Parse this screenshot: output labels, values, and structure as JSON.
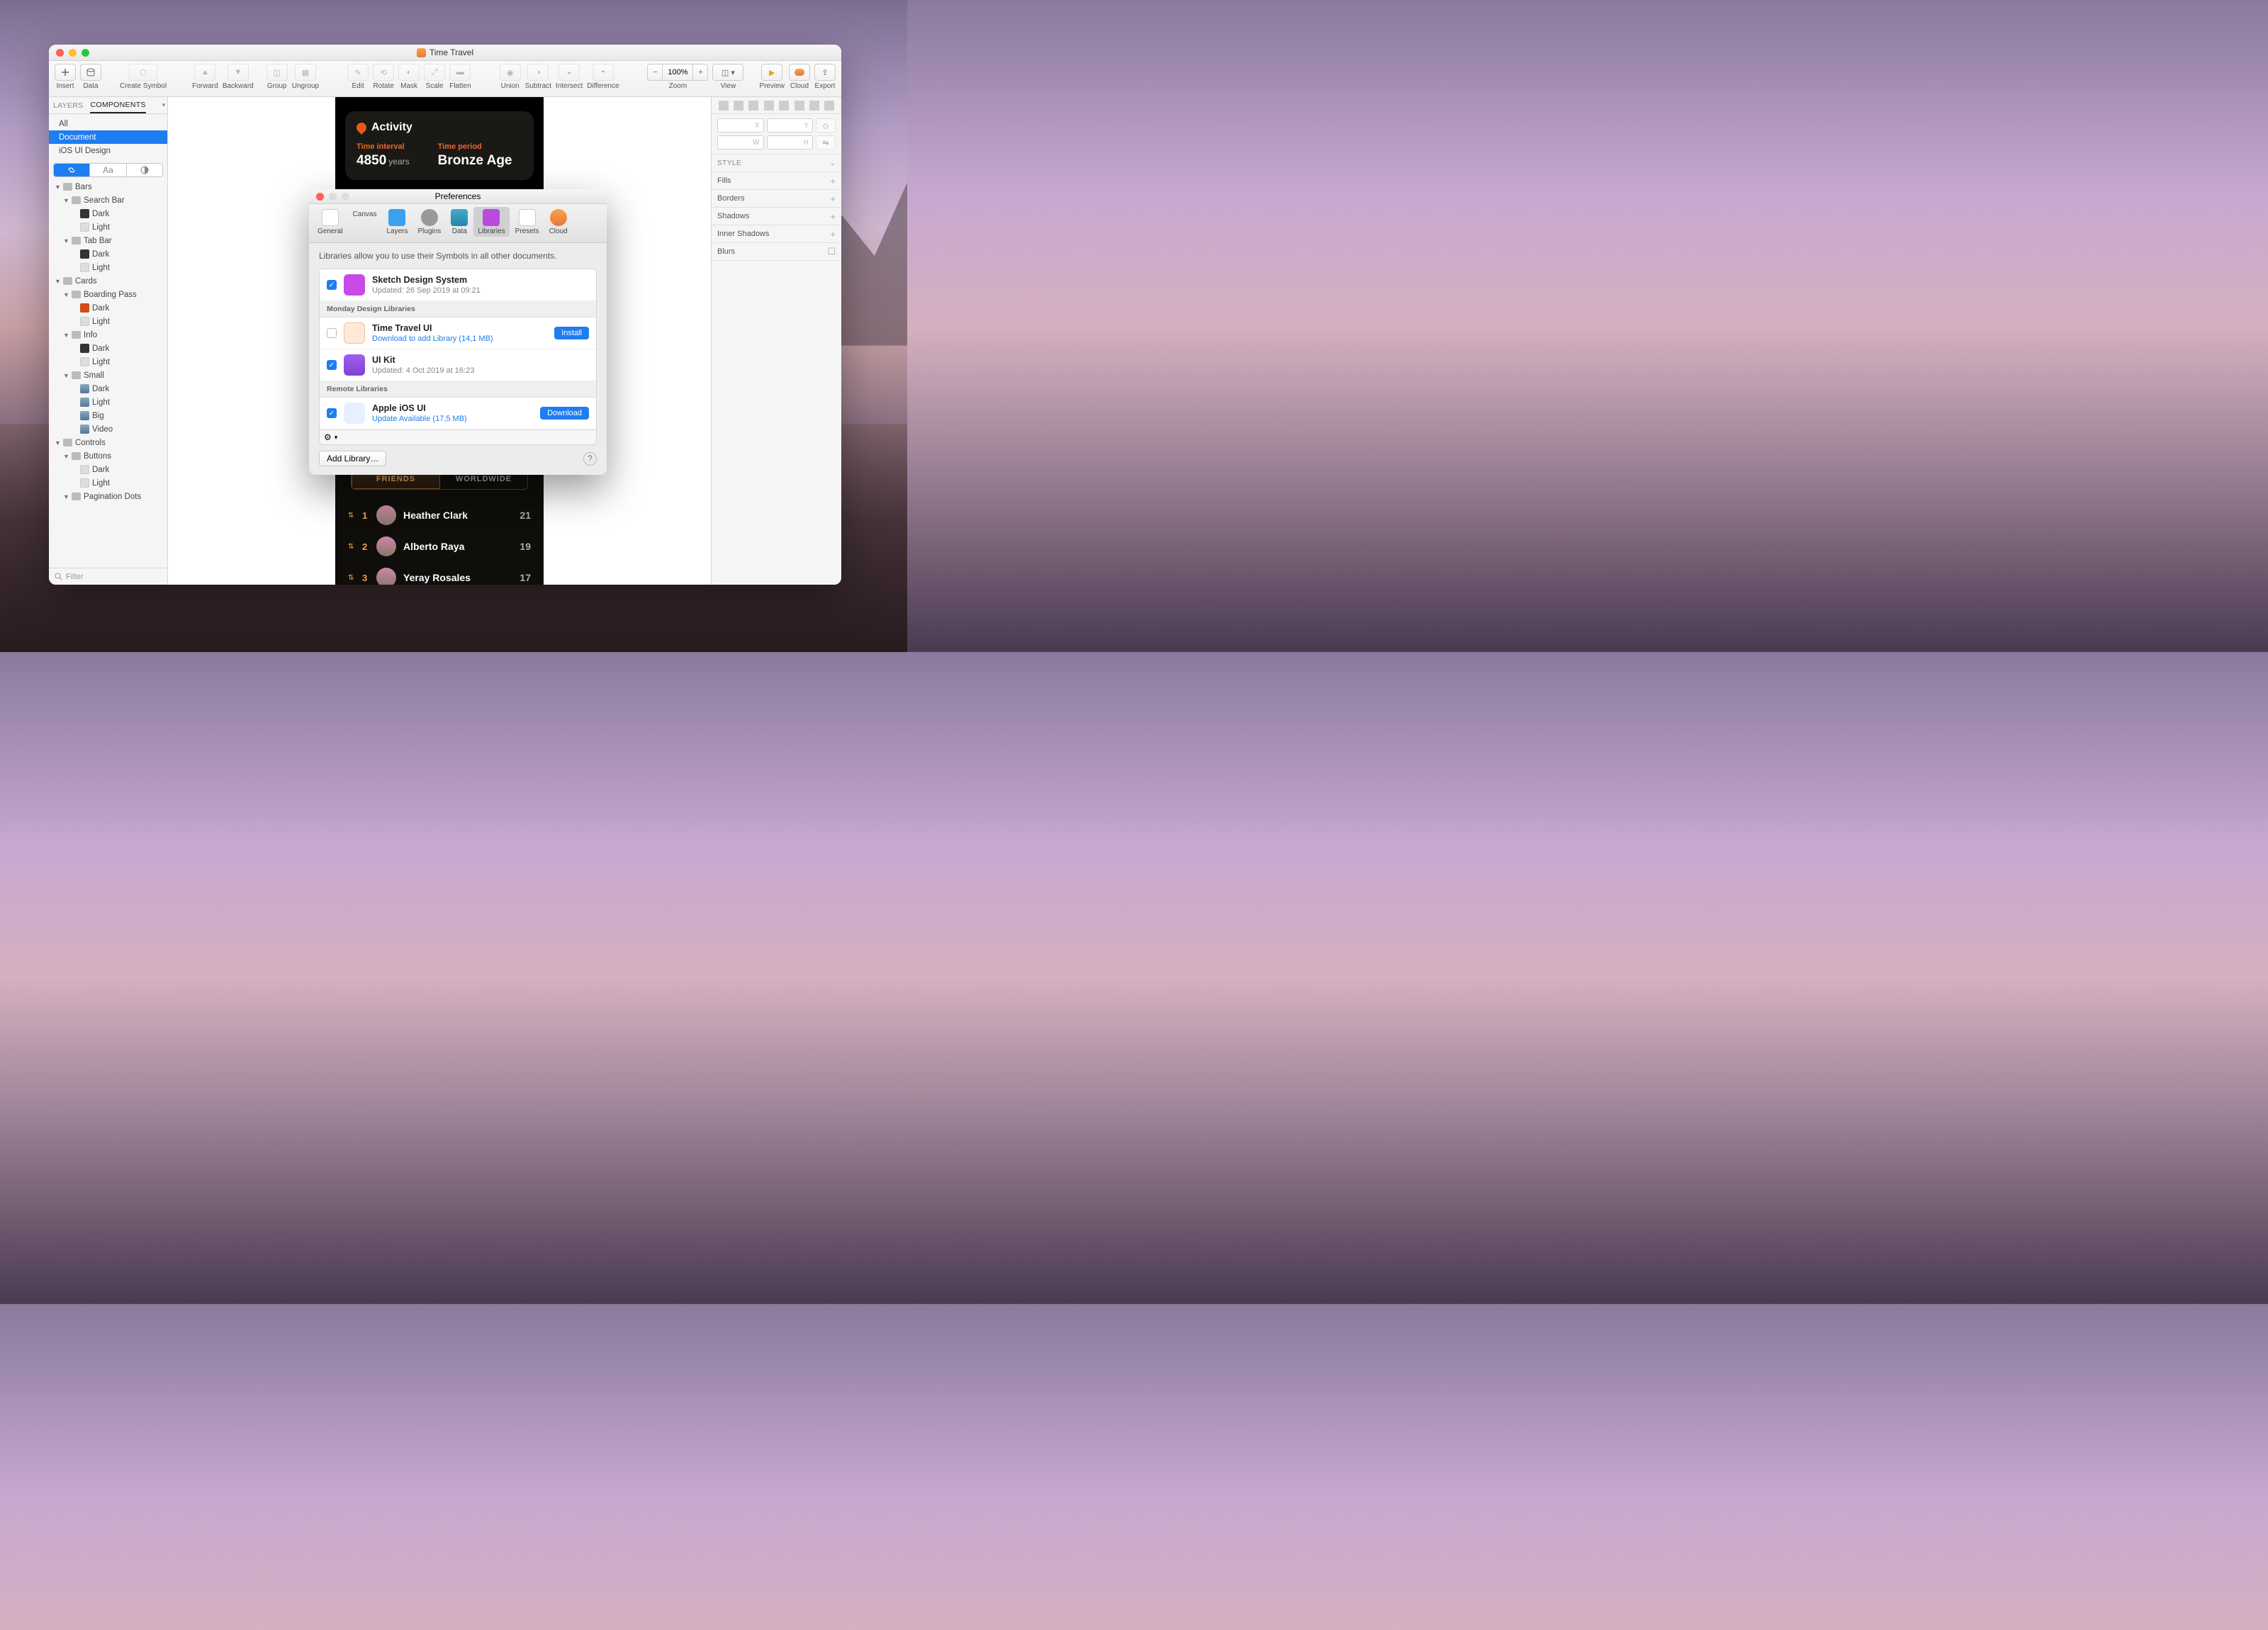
{
  "window": {
    "title": "Time Travel"
  },
  "toolbar": {
    "insert": "Insert",
    "data": "Data",
    "create_symbol": "Create Symbol",
    "forward": "Forward",
    "backward": "Backward",
    "group": "Group",
    "ungroup": "Ungroup",
    "edit": "Edit",
    "rotate": "Rotate",
    "mask": "Mask",
    "scale": "Scale",
    "flatten": "Flatten",
    "union": "Union",
    "subtract": "Subtract",
    "intersect": "Intersect",
    "difference": "Difference",
    "zoom": "Zoom",
    "zoom_value": "100%",
    "view": "View",
    "preview": "Preview",
    "cloud": "Cloud",
    "export": "Export"
  },
  "sidebar": {
    "tabs": {
      "layers": "LAYERS",
      "components": "COMPONENTS"
    },
    "scope": {
      "all": "All",
      "document": "Document",
      "ios": "iOS UI Design"
    },
    "seg": {
      "a": "↻",
      "b": "Aa",
      "c": "◑"
    },
    "tree": [
      {
        "l": 1,
        "d": "▼",
        "i": "f",
        "t": "Bars"
      },
      {
        "l": 2,
        "d": "▼",
        "i": "f",
        "t": "Search Bar"
      },
      {
        "l": 3,
        "d": "",
        "i": "dark",
        "t": "Dark"
      },
      {
        "l": 3,
        "d": "",
        "i": "light",
        "t": "Light"
      },
      {
        "l": 2,
        "d": "▼",
        "i": "f",
        "t": "Tab Bar"
      },
      {
        "l": 3,
        "d": "",
        "i": "dark",
        "t": "Dark"
      },
      {
        "l": 3,
        "d": "",
        "i": "light",
        "t": "Light"
      },
      {
        "l": 1,
        "d": "▼",
        "i": "f",
        "t": "Cards"
      },
      {
        "l": 2,
        "d": "▼",
        "i": "f",
        "t": "Boarding Pass"
      },
      {
        "l": 3,
        "d": "",
        "i": "o1",
        "t": "Dark"
      },
      {
        "l": 3,
        "d": "",
        "i": "light",
        "t": "Light"
      },
      {
        "l": 2,
        "d": "▼",
        "i": "f",
        "t": "Info"
      },
      {
        "l": 3,
        "d": "",
        "i": "dark",
        "t": "Dark"
      },
      {
        "l": 3,
        "d": "",
        "i": "light",
        "t": "Light"
      },
      {
        "l": 2,
        "d": "▼",
        "i": "f",
        "t": "Small"
      },
      {
        "l": 3,
        "d": "",
        "i": "pic",
        "t": "Dark"
      },
      {
        "l": 3,
        "d": "",
        "i": "pic",
        "t": "Light"
      },
      {
        "l": 3,
        "d": "",
        "i": "pic",
        "t": "Big"
      },
      {
        "l": 3,
        "d": "",
        "i": "pic",
        "t": "Video"
      },
      {
        "l": 1,
        "d": "▼",
        "i": "f",
        "t": "Controls"
      },
      {
        "l": 2,
        "d": "▼",
        "i": "f",
        "t": "Buttons"
      },
      {
        "l": 3,
        "d": "",
        "i": "light",
        "t": "Dark"
      },
      {
        "l": 3,
        "d": "",
        "i": "light",
        "t": "Light"
      },
      {
        "l": 2,
        "d": "▼",
        "i": "f",
        "t": "Pagination Dots"
      }
    ],
    "filter": "Filter"
  },
  "canvas": {
    "activity": {
      "title": "Activity",
      "interval_label": "Time interval",
      "interval_value": "4850",
      "interval_unit": "years",
      "period_label": "Time period",
      "period_value": "Bronze Age"
    },
    "leaderboard": {
      "tab_friends": "Friends",
      "tab_world": "Worldwide",
      "rows": [
        {
          "rank": "1",
          "name": "Heather Clark",
          "score": "21"
        },
        {
          "rank": "2",
          "name": "Alberto Raya",
          "score": "19"
        },
        {
          "rank": "3",
          "name": "Yeray Rosales",
          "score": "17"
        }
      ]
    }
  },
  "inspector": {
    "style": "STYLE",
    "sections": [
      "Fills",
      "Borders",
      "Shadows",
      "Inner Shadows",
      "Blurs"
    ],
    "pos": {
      "x": "X",
      "y": "Y",
      "w": "W",
      "h": "H"
    }
  },
  "preferences": {
    "title": "Preferences",
    "tabs": [
      "General",
      "Canvas",
      "Layers",
      "Plugins",
      "Data",
      "Libraries",
      "Presets",
      "Cloud"
    ],
    "desc": "Libraries allow you to use their Symbols in all other documents.",
    "groups": {
      "monday": "Monday Design Libraries",
      "remote": "Remote Libraries"
    },
    "libs": [
      {
        "checked": true,
        "name": "Sketch Design System",
        "sub": "Updated: 26 Sep 2019 at 09:21",
        "link": false,
        "thumb": "th1",
        "btn": ""
      },
      {
        "checked": false,
        "name": "Time Travel UI",
        "sub": "Download to add Library (14,1 MB)",
        "link": true,
        "thumb": "th2",
        "btn": "Install"
      },
      {
        "checked": true,
        "name": "UI Kit",
        "sub": "Updated: 4 Oct 2019 at 16:23",
        "link": false,
        "thumb": "th3",
        "btn": ""
      },
      {
        "checked": true,
        "name": "Apple iOS UI",
        "sub": "Update Available (17,5 MB)",
        "link": true,
        "thumb": "th4",
        "btn": "Download"
      }
    ],
    "add": "Add Library…"
  }
}
